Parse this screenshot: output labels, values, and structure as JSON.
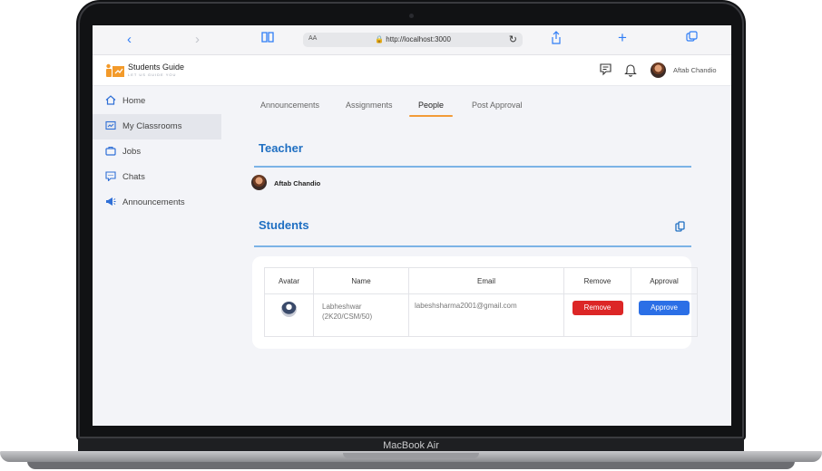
{
  "device": {
    "label": "MacBook Air"
  },
  "browser": {
    "aa": "AA",
    "url": "http://localhost:3000",
    "icons": [
      "back-icon",
      "forward-icon",
      "book-icon",
      "lock-icon",
      "reload-icon",
      "share-icon",
      "plus-icon",
      "tabs-icon"
    ]
  },
  "header": {
    "title": "Students Guide",
    "tagline": "LET US GUIDE YOU",
    "user_name": "Aftab Chandio"
  },
  "sidebar": {
    "items": [
      {
        "label": "Home",
        "icon": "home-icon"
      },
      {
        "label": "My Classrooms",
        "icon": "classroom-icon"
      },
      {
        "label": "Jobs",
        "icon": "briefcase-icon"
      },
      {
        "label": "Chats",
        "icon": "chat-icon"
      },
      {
        "label": "Announcements",
        "icon": "megaphone-icon"
      }
    ],
    "active": "My Classrooms"
  },
  "tabs": [
    {
      "label": "Announcements"
    },
    {
      "label": "Assignments"
    },
    {
      "label": "People"
    },
    {
      "label": "Post Approval"
    }
  ],
  "active_tab": "People",
  "teacher": {
    "title": "Teacher",
    "name": "Aftab Chandio"
  },
  "students": {
    "title": "Students",
    "columns": [
      "Avatar",
      "Name",
      "Email",
      "Remove",
      "Approval"
    ],
    "rows": [
      {
        "name": "Labheshwar",
        "roll": "(2K20/CSM/50)",
        "email": "labeshsharma2001@gmail.com",
        "remove_label": "Remove",
        "approve_label": "Approve"
      }
    ]
  },
  "colors": {
    "accent": "#1f6fc2",
    "remove": "#dc2626",
    "approve": "#2b6fe6",
    "tab_underline": "#f29b38"
  }
}
